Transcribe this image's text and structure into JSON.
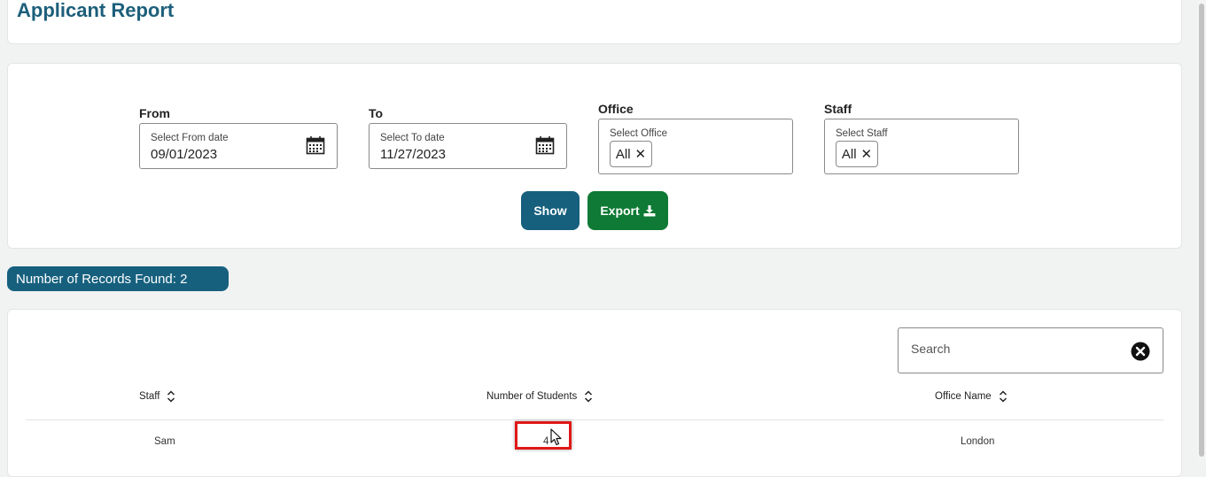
{
  "page": {
    "title": "Applicant Report"
  },
  "filters": {
    "from": {
      "label": "From",
      "hint": "Select From date",
      "value": "09/01/2023"
    },
    "to": {
      "label": "To",
      "hint": "Select To date",
      "value": "11/27/2023"
    },
    "office": {
      "label": "Office",
      "hint": "Select Office",
      "chip": "All"
    },
    "staff": {
      "label": "Staff",
      "hint": "Select Staff",
      "chip": "All"
    },
    "show_label": "Show",
    "export_label": "Export"
  },
  "records": {
    "text": "Number of Records Found: 2"
  },
  "search": {
    "placeholder": "Search"
  },
  "table": {
    "columns": [
      "Staff",
      "Number of Students",
      "Office Name"
    ],
    "rows": [
      {
        "staff": "Sam",
        "students": "4",
        "office": "London"
      }
    ]
  },
  "colors": {
    "title": "#1d5f7a",
    "primary": "#16607e",
    "export": "#0e7a35",
    "highlight": "#e01818"
  },
  "icons": [
    "calendar-icon",
    "close-icon",
    "download-icon",
    "sort-icon",
    "clear-search-icon",
    "mouse-cursor-icon"
  ]
}
